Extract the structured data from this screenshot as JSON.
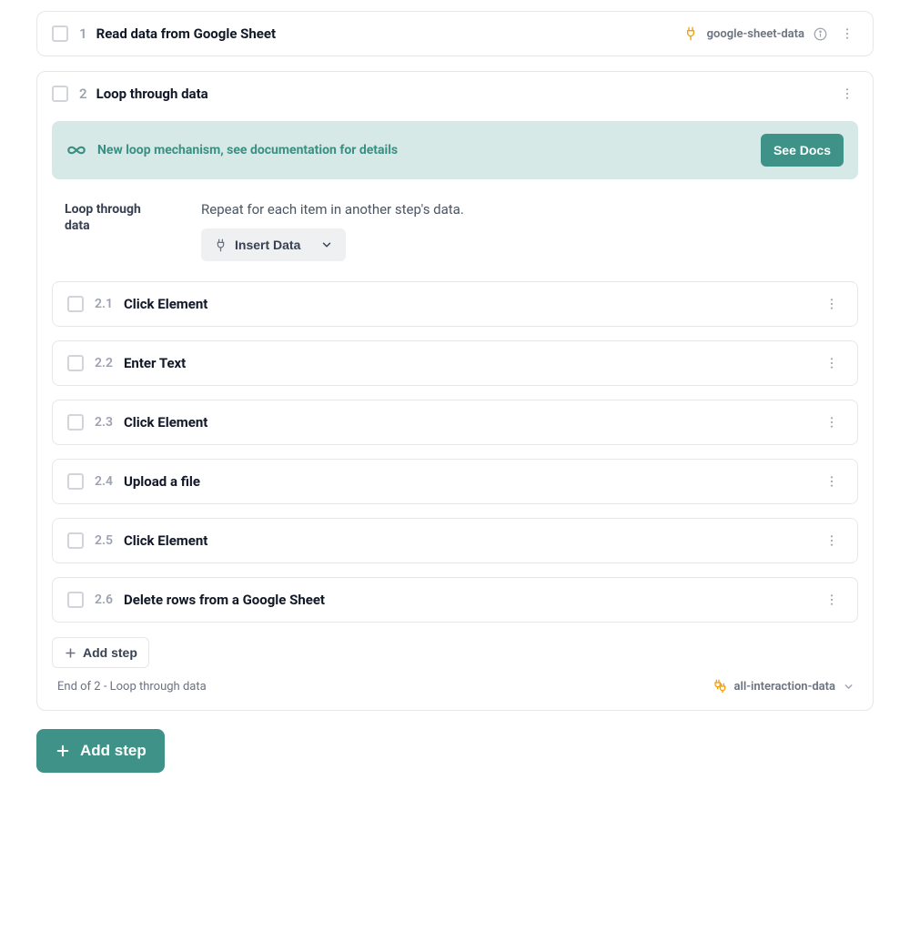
{
  "step1": {
    "num": "1",
    "title": "Read data from Google Sheet",
    "tag": "google-sheet-data"
  },
  "step2": {
    "num": "2",
    "title": "Loop through data",
    "banner_text": "New loop mechanism, see documentation for details",
    "see_docs": "See Docs",
    "config_label": "Loop through data",
    "config_desc": "Repeat for each item in another step's data.",
    "insert_data": "Insert Data",
    "substeps": [
      {
        "num": "2.1",
        "title": "Click Element"
      },
      {
        "num": "2.2",
        "title": "Enter Text"
      },
      {
        "num": "2.3",
        "title": "Click Element"
      },
      {
        "num": "2.4",
        "title": "Upload a file"
      },
      {
        "num": "2.5",
        "title": "Click Element"
      },
      {
        "num": "2.6",
        "title": "Delete rows from a Google Sheet"
      }
    ],
    "add_step": "Add step",
    "end_text": "End of 2 - Loop through data",
    "end_tag": "all-interaction-data"
  },
  "add_step_primary": "Add step"
}
